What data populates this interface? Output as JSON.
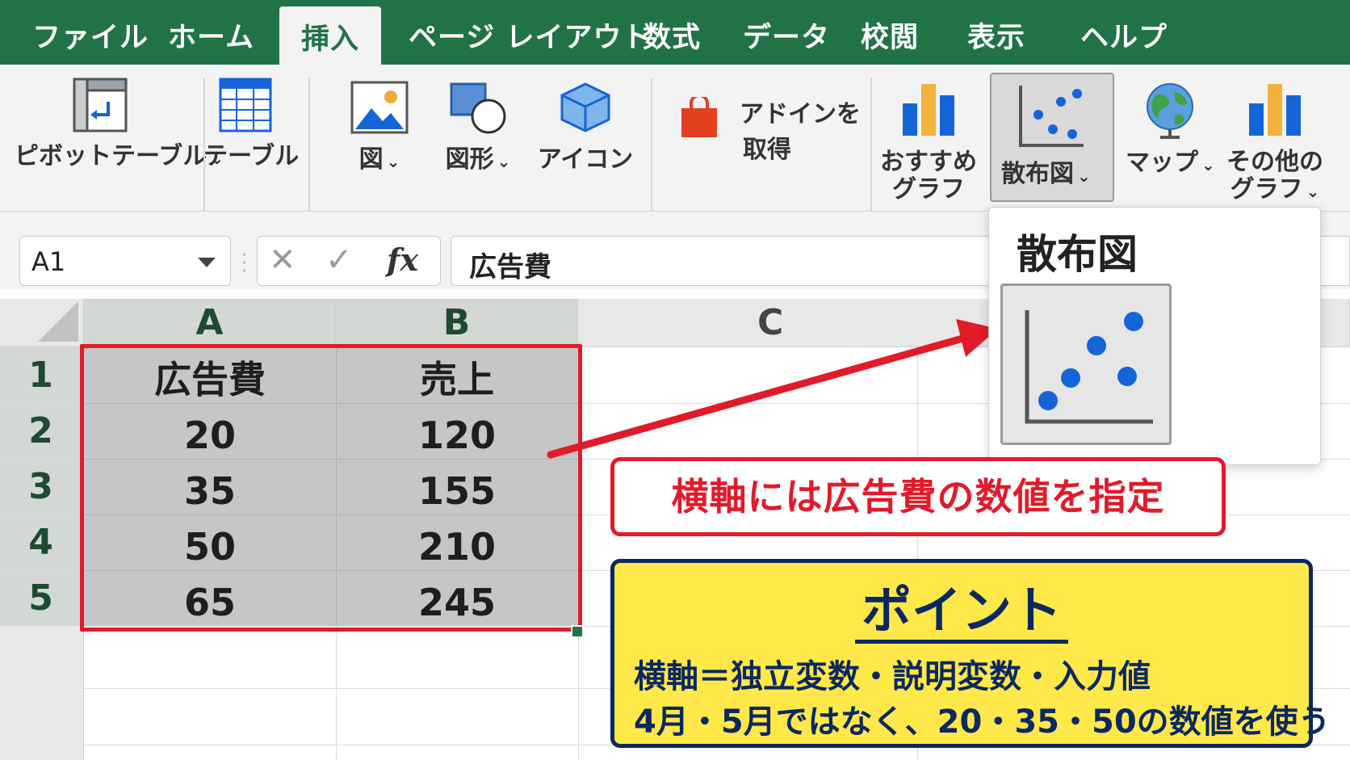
{
  "menu": {
    "tabs": [
      "ファイル",
      "ホーム",
      "挿入",
      "ページ レイアウト",
      "数式",
      "データ",
      "校閲",
      "表示",
      "ヘルプ"
    ],
    "active_tab": "挿入"
  },
  "ribbon": {
    "pivot_table": "ピボットテーブル",
    "table": "テーブル",
    "picture": "図",
    "shapes": "図形",
    "icons": "アイコン",
    "addins_line1": "アドインを",
    "addins_line2": "取得",
    "recommended_line1": "おすすめ",
    "recommended_line2": "グラフ",
    "scatter": "散布図",
    "maps": "マップ",
    "other_line1": "その他の",
    "other_line2": "グラフ",
    "caret": "⌄"
  },
  "formula_bar": {
    "name_box": "A1",
    "cancel": "✕",
    "enter": "✓",
    "fx": "fx",
    "content": "広告費"
  },
  "sheet": {
    "columns": [
      "A",
      "B",
      "C"
    ],
    "rows": [
      "1",
      "2",
      "3",
      "4",
      "5"
    ],
    "table": {
      "headers": [
        "広告費",
        "売上"
      ],
      "data": [
        [
          "20",
          "120"
        ],
        [
          "35",
          "155"
        ],
        [
          "50",
          "210"
        ],
        [
          "65",
          "245"
        ]
      ]
    }
  },
  "popup": {
    "title": "散布図"
  },
  "callout": {
    "text": "横軸には広告費の数値を指定"
  },
  "point": {
    "title": "ポイント",
    "line1": "横軸＝独立変数・説明変数・入力値",
    "line2": "4月・5月ではなく、20・35・50の数値を使う"
  },
  "colors": {
    "excel_green": "#217346",
    "accent_red": "#e01b2a",
    "point_yellow": "#ffe84a",
    "point_navy": "#0c2860",
    "scatter_blue": "#1565d8"
  }
}
